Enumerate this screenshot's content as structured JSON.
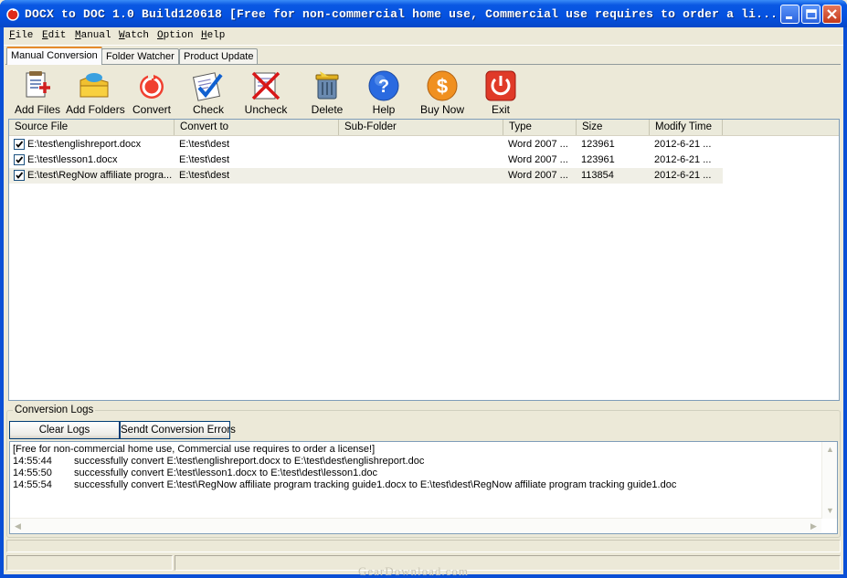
{
  "window": {
    "title": "DOCX to DOC 1.0 Build120618 [Free for non-commercial home use, Commercial use requires to order a li..."
  },
  "menu": [
    {
      "label": "File",
      "key": "F"
    },
    {
      "label": "Edit",
      "key": "E"
    },
    {
      "label": "Manual",
      "key": "M"
    },
    {
      "label": "Watch",
      "key": "W"
    },
    {
      "label": "Option",
      "key": "O"
    },
    {
      "label": "Help",
      "key": "H"
    }
  ],
  "tabs": [
    {
      "label": "Manual Conversion",
      "active": true
    },
    {
      "label": "Folder Watcher",
      "active": false
    },
    {
      "label": "Product Update",
      "active": false
    }
  ],
  "toolbar": {
    "add_files": "Add Files",
    "add_folders": "Add Folders",
    "convert": "Convert",
    "check": "Check",
    "uncheck": "Uncheck",
    "delete": "Delete",
    "help": "Help",
    "buy_now": "Buy Now",
    "exit": "Exit"
  },
  "file_list": {
    "columns": [
      "Source File",
      "Convert to",
      "Sub-Folder",
      "Type",
      "Size",
      "Modify Time"
    ],
    "rows": [
      {
        "checked": true,
        "source": "E:\\test\\englishreport.docx",
        "convert_to": "E:\\test\\dest",
        "sub_folder": "",
        "type": "Word 2007 ...",
        "size": "123961",
        "modified": "2012-6-21  ..."
      },
      {
        "checked": true,
        "source": "E:\\test\\lesson1.docx",
        "convert_to": "E:\\test\\dest",
        "sub_folder": "",
        "type": "Word 2007 ...",
        "size": "123961",
        "modified": "2012-6-21  ..."
      },
      {
        "checked": true,
        "source": "E:\\test\\RegNow affiliate progra...",
        "convert_to": "E:\\test\\dest",
        "sub_folder": "",
        "type": "Word 2007 ...",
        "size": "113854",
        "modified": "2012-6-21  ..."
      }
    ]
  },
  "logs": {
    "group_label": "Conversion Logs",
    "clear_button": "Clear Logs",
    "send_button": "Sendt Conversion Errors",
    "header_line": "[Free for non-commercial home use, Commercial use requires to order a license!]",
    "entries": [
      {
        "time": "14:55:44",
        "message": "successfully convert E:\\test\\englishreport.docx to E:\\test\\dest\\englishreport.doc"
      },
      {
        "time": "14:55:50",
        "message": "successfully convert E:\\test\\lesson1.docx to E:\\test\\dest\\lesson1.doc"
      },
      {
        "time": "14:55:54",
        "message": "successfully convert E:\\test\\RegNow affiliate program tracking guide1.docx to E:\\test\\dest\\RegNow affiliate program tracking guide1.doc"
      }
    ]
  },
  "watermark": "GearDownload.com"
}
